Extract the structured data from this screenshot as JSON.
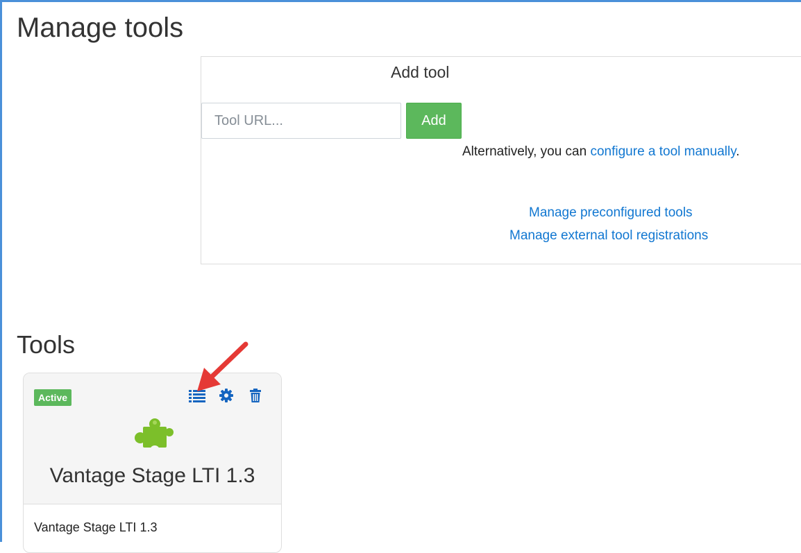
{
  "page": {
    "title": "Manage tools"
  },
  "add_tool": {
    "title": "Add tool",
    "url_placeholder": "Tool URL...",
    "add_label": "Add",
    "alt_prefix": "Alternatively, you can ",
    "alt_link": "configure a tool manually",
    "alt_suffix": ".",
    "preconfigured_link": "Manage preconfigured tools",
    "registrations_link": "Manage external tool registrations"
  },
  "tools": {
    "heading": "Tools",
    "cards": [
      {
        "status": "Active",
        "name": "Vantage Stage LTI 1.3",
        "body_name": "Vantage Stage LTI 1.3",
        "icons": [
          "list-icon",
          "gear-icon",
          "trash-icon",
          "puzzle-piece-icon"
        ]
      }
    ]
  },
  "colors": {
    "accent_green": "#5cb85c",
    "link_blue": "#1177d1",
    "icon_blue": "#1565c0",
    "puzzle_green": "#7cbf2a",
    "annotation_red": "#e53935",
    "frame_blue": "#4a90d9"
  }
}
